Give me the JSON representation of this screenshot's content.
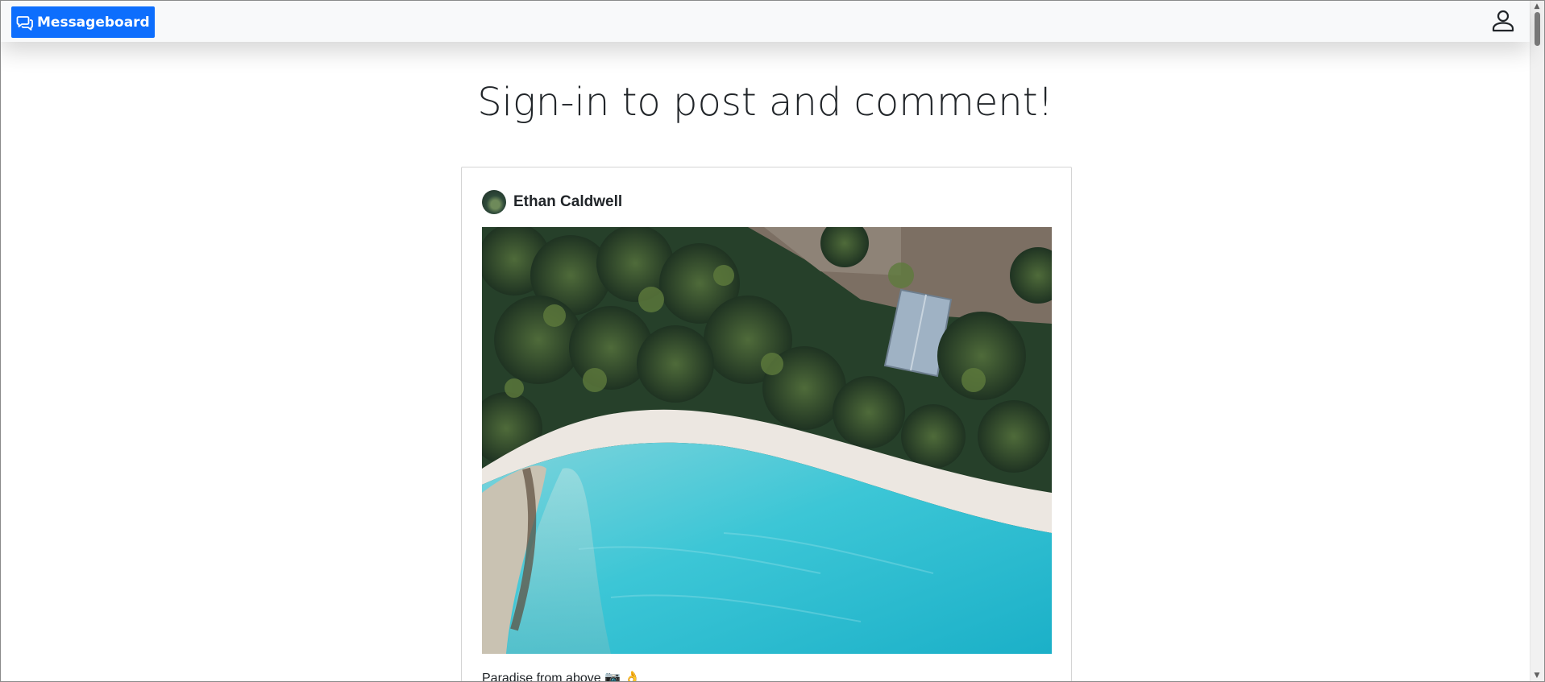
{
  "navbar": {
    "brand_label": "Messageboard",
    "brand_icon": "chat-bubbles-icon",
    "user_icon": "user-icon",
    "brand_color": "#0d6efd"
  },
  "main": {
    "title": "Sign-in to post and comment!"
  },
  "post": {
    "author": "Ethan Caldwell",
    "image_description_icon": "aerial-beach-photo",
    "caption": "Paradise from above 📷 👌"
  }
}
